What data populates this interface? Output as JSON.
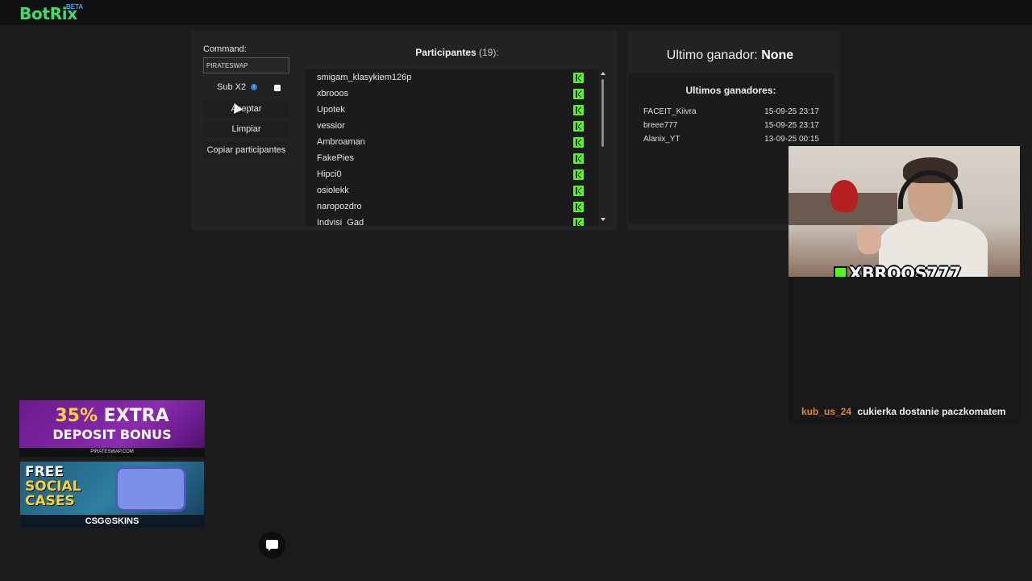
{
  "brand": {
    "name": "BotRix",
    "badge": "BETA"
  },
  "giveaway": {
    "command_label": "Command:",
    "command_value": "PIRATESWAP",
    "sub_label": "Sub X2",
    "sub_info_icon": "info-icon",
    "sub_checked": false,
    "accept_label": "Aceptar",
    "clear_label": "Limpiar",
    "copy_label": "Copiar participantes",
    "participants_title": "Participantes",
    "participants_count": "(19):",
    "participants": [
      "smigam_klasykiem126p",
      "xbrooos",
      "Upotek",
      "vessior",
      "Ambroaman",
      "FakePies",
      "Hipci0",
      "osiolekk",
      "naropozdro",
      "Indvisi_Gad"
    ],
    "platform_icon": "kick-icon"
  },
  "winners": {
    "last_winner_label": "Ultimo ganador:",
    "last_winner_value": "None",
    "history_title": "Ultimos ganadores:",
    "history": [
      {
        "name": "FACEIT_Kiivra",
        "date": "15-09-25 23:17"
      },
      {
        "name": "breee777",
        "date": "15-09-25 23:17"
      },
      {
        "name": "Alanix_YT",
        "date": "13-09-25 00:15"
      }
    ]
  },
  "webcam": {
    "tag": "XBROOS777"
  },
  "chat": {
    "user": "kub_us_24",
    "message": "cukierka dostanie paczkomatem"
  },
  "ads": {
    "ad1": {
      "line1_pct": "35%",
      "line1_rest": " EXTRA",
      "line2": "DEPOSIT BONUS",
      "site": "PIRATESWAP.COM"
    },
    "ad2": {
      "line1": "FREE",
      "line2": "SOCIAL",
      "line3": "CASES",
      "brand": "CSG⊙SKINS"
    }
  },
  "colors": {
    "accent": "#3ddc6b",
    "kick": "#53fc18",
    "chat_user": "#e0872b",
    "panel": "#222222"
  }
}
